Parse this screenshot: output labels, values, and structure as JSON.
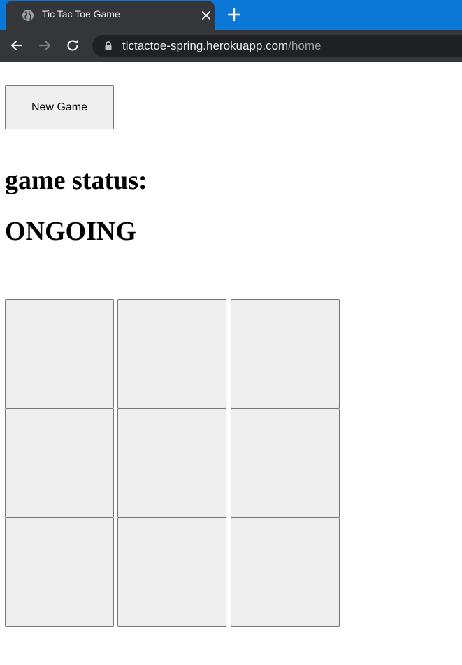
{
  "browser": {
    "tab_title": "Tic Tac Toe Game",
    "url_host": "tictactoe-spring.herokuapp.com",
    "url_path": "/home",
    "accent_color": "#0b78d8"
  },
  "page": {
    "new_game_label": "New Game",
    "status_label": "game status:",
    "status_value": "ONGOING",
    "board": {
      "cells": [
        "",
        "",
        "",
        "",
        "",
        "",
        "",
        "",
        ""
      ]
    }
  }
}
